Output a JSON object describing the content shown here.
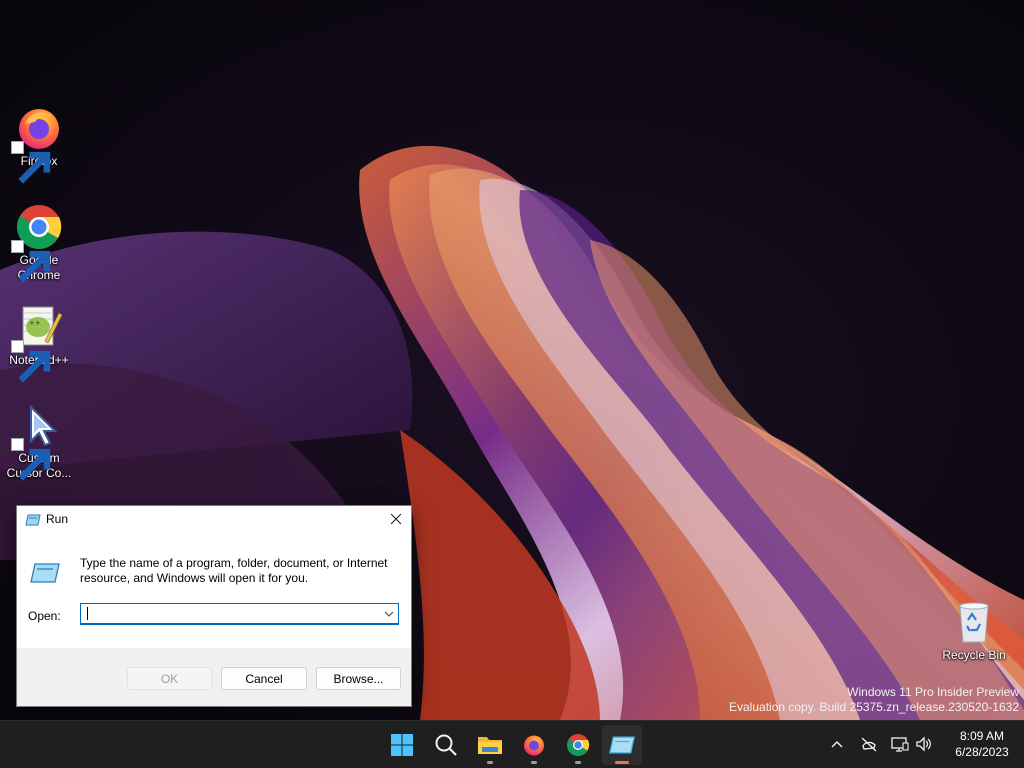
{
  "desktop": {
    "icons": [
      {
        "label": "Firefox",
        "icon": "firefox-icon"
      },
      {
        "label": "Google Chrome",
        "icon": "chrome-icon"
      },
      {
        "label": "Notepad++",
        "icon": "notepadpp-icon"
      },
      {
        "label": "Custom Cursor Co...",
        "icon": "custom-cursor-icon"
      },
      {
        "label": "Recycle Bin",
        "icon": "recycle-bin-icon"
      }
    ],
    "watermark": {
      "line1": "Windows 11 Pro Insider Preview",
      "line2": "Evaluation copy. Build 25375.zn_release.230520-1632"
    }
  },
  "run_dialog": {
    "title": "Run",
    "description": "Type the name of a program, folder, document, or Internet resource, and Windows will open it for you.",
    "open_label": "Open:",
    "open_value": "",
    "buttons": {
      "ok": "OK",
      "cancel": "Cancel",
      "browse": "Browse..."
    },
    "ok_enabled": false
  },
  "taskbar": {
    "items": [
      {
        "name": "start",
        "icon": "windows-start-icon",
        "running": false
      },
      {
        "name": "search",
        "icon": "search-icon",
        "running": false
      },
      {
        "name": "file-explorer",
        "icon": "folder-icon",
        "running": true
      },
      {
        "name": "firefox",
        "icon": "firefox-icon",
        "running": true
      },
      {
        "name": "chrome",
        "icon": "chrome-icon",
        "running": true
      },
      {
        "name": "run",
        "icon": "run-icon",
        "running": true,
        "active": true
      }
    ],
    "tray": [
      "chevron-up-icon",
      "network-disconnected-icon",
      "monitor-icon",
      "volume-icon"
    ],
    "clock": {
      "time": "8:09 AM",
      "date": "6/28/2023"
    }
  },
  "colors": {
    "accent": "#0067c0",
    "taskbar": "#1f1f1f",
    "active_indicator": "#e6735a"
  }
}
